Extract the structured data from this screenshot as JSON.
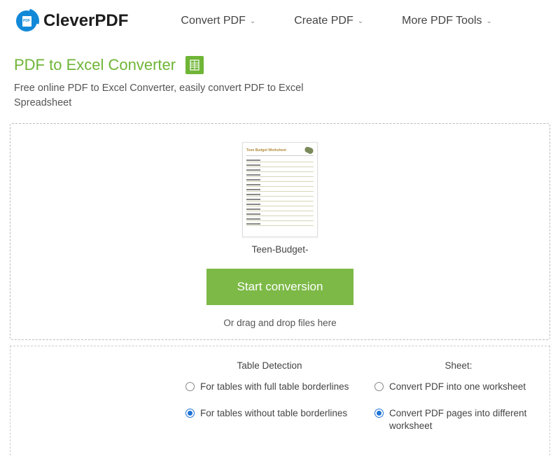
{
  "brand": "CleverPDF",
  "nav": {
    "convert": "Convert PDF",
    "create": "Create PDF",
    "more": "More PDF Tools"
  },
  "page": {
    "title": "PDF to Excel Converter",
    "subtitle": "Free online PDF to Excel Converter, easily convert PDF to Excel Spreadsheet"
  },
  "upload": {
    "file_name": "Teen-Budget-",
    "start_label": "Start conversion",
    "drag_hint": "Or drag and drop files here",
    "preview_title": "Teen Budget Worksheet"
  },
  "options": {
    "table_detection": {
      "title": "Table Detection",
      "full": "For tables with full table borderlines",
      "without": "For tables without table borderlines"
    },
    "sheet": {
      "title": "Sheet:",
      "one": "Convert PDF into one worksheet",
      "multi": "Convert PDF pages into different worksheet"
    }
  }
}
